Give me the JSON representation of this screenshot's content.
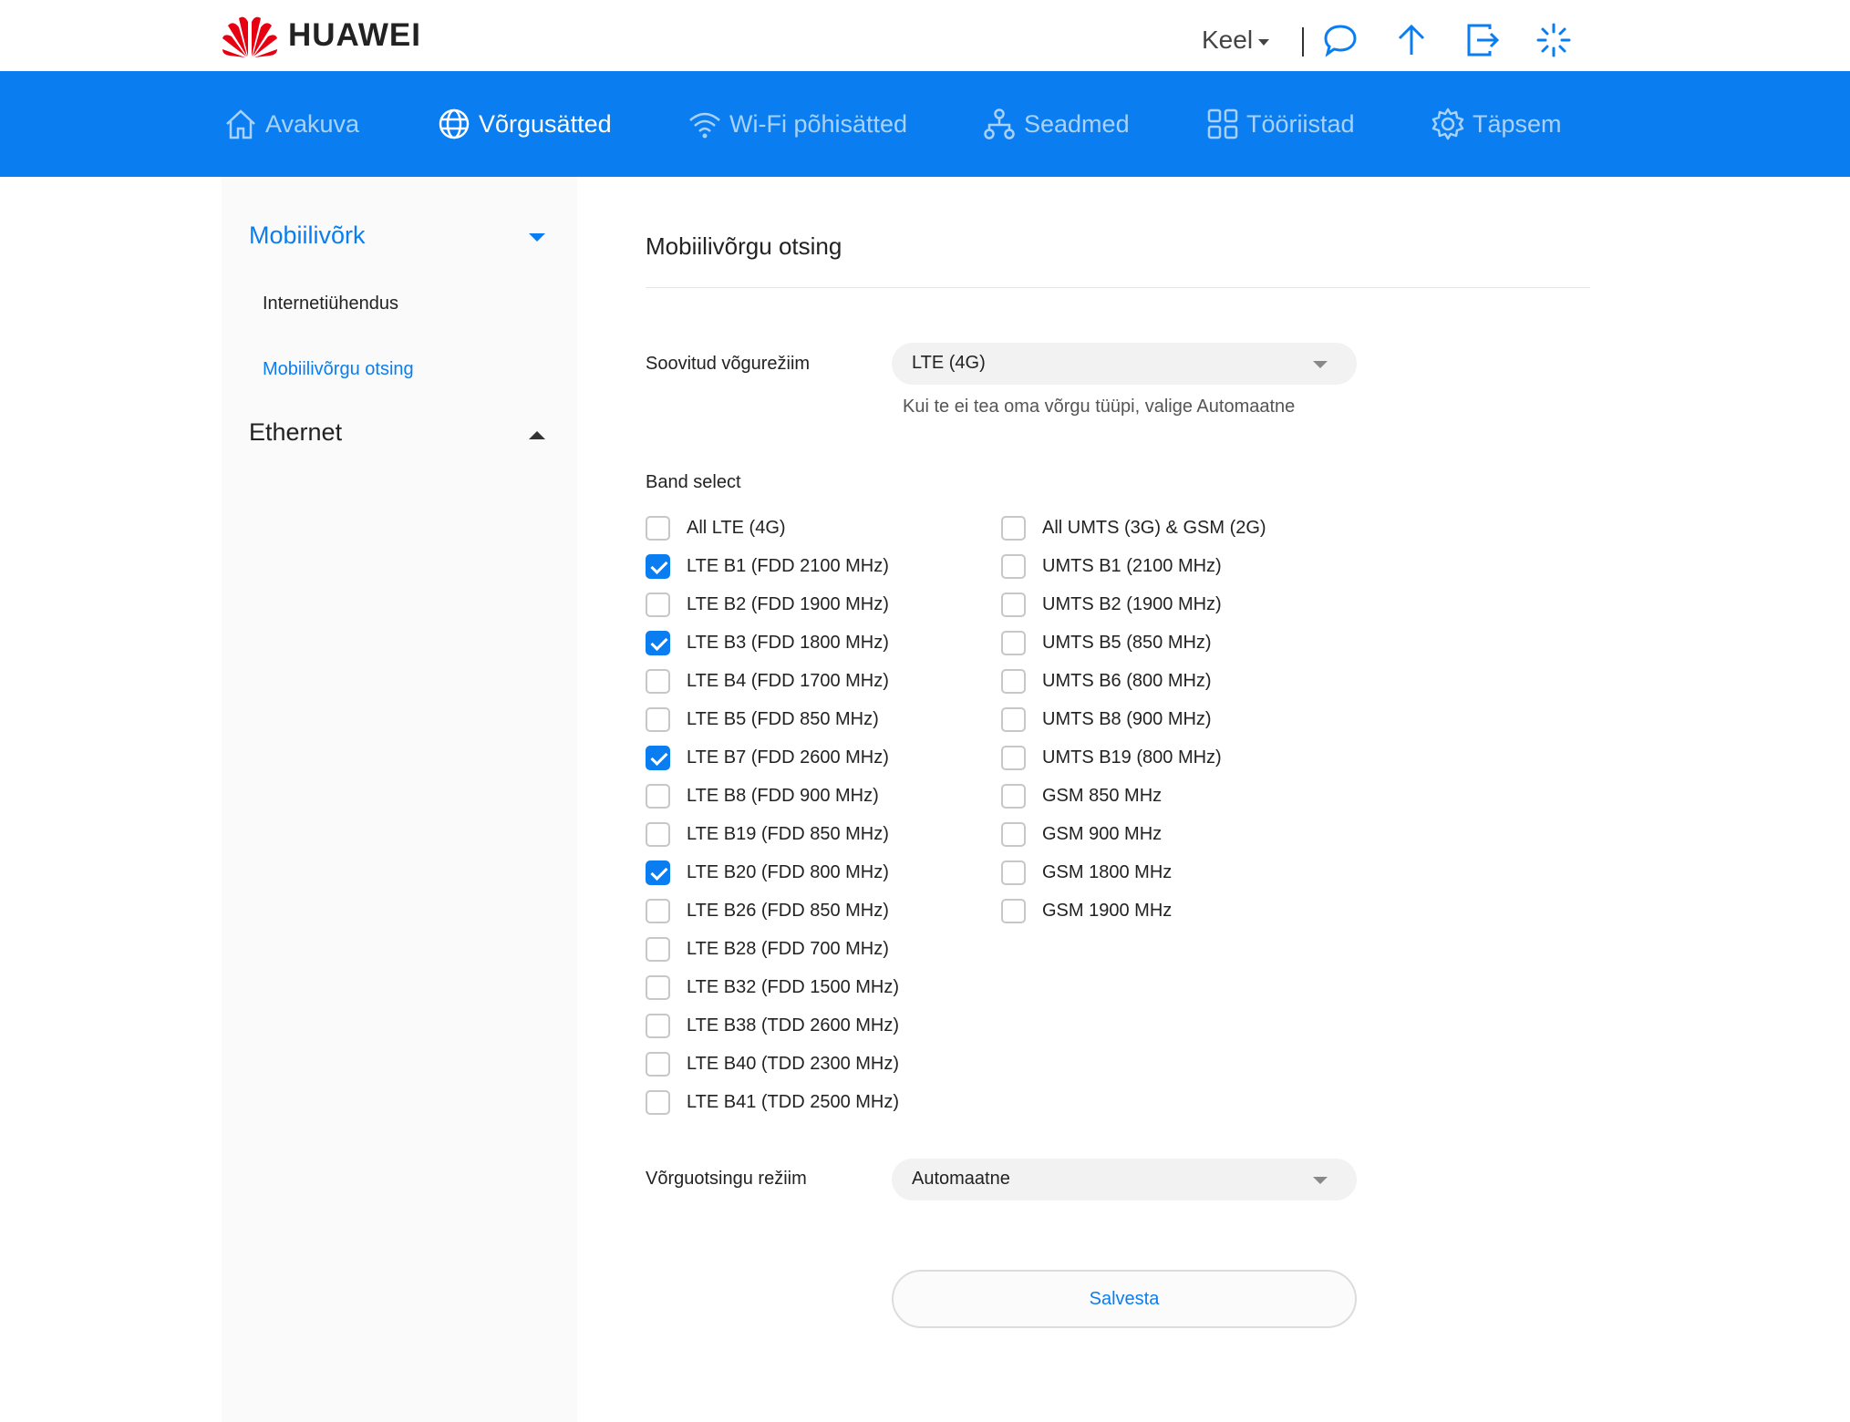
{
  "brand": {
    "name": "HUAWEI",
    "logo_color": "#e60012"
  },
  "top_actions": {
    "language_label": "Keel",
    "icons": [
      "chat-icon",
      "upload-icon",
      "logout-icon",
      "loading-icon"
    ]
  },
  "colors": {
    "accent": "#0a7ef0",
    "nav_inactive": "#a9d2fb"
  },
  "nav": {
    "items": [
      {
        "label": "Avakuva",
        "icon": "home-icon"
      },
      {
        "label": "Võrgusätted",
        "icon": "globe-icon",
        "active": true
      },
      {
        "label": "Wi-Fi põhisätted",
        "icon": "wifi-icon"
      },
      {
        "label": "Seadmed",
        "icon": "devices-icon"
      },
      {
        "label": "Tööriistad",
        "icon": "tools-icon"
      },
      {
        "label": "Täpsem",
        "icon": "gear-icon"
      }
    ]
  },
  "sidebar": {
    "sections": [
      {
        "label": "Mobiilivõrk",
        "expanded": true,
        "items": [
          {
            "label": "Internetiühendus"
          },
          {
            "label": "Mobiilivõrgu otsing",
            "active": true
          }
        ]
      },
      {
        "label": "Ethernet",
        "expanded": false
      }
    ]
  },
  "main": {
    "title": "Mobiilivõrgu otsing",
    "preferred_mode": {
      "label": "Soovitud võgurežiim",
      "value": "LTE (4G)",
      "hint": "Kui te ei tea oma võrgu tüüpi, valige Automaatne"
    },
    "band_select": {
      "title": "Band select",
      "left": [
        {
          "label": "All LTE (4G)",
          "checked": false
        },
        {
          "label": "LTE B1 (FDD 2100 MHz)",
          "checked": true
        },
        {
          "label": "LTE B2 (FDD 1900 MHz)",
          "checked": false
        },
        {
          "label": "LTE B3 (FDD 1800 MHz)",
          "checked": true
        },
        {
          "label": "LTE B4 (FDD 1700 MHz)",
          "checked": false
        },
        {
          "label": "LTE B5 (FDD 850 MHz)",
          "checked": false
        },
        {
          "label": "LTE B7 (FDD 2600 MHz)",
          "checked": true
        },
        {
          "label": "LTE B8 (FDD 900 MHz)",
          "checked": false
        },
        {
          "label": "LTE B19 (FDD 850 MHz)",
          "checked": false
        },
        {
          "label": "LTE B20 (FDD 800 MHz)",
          "checked": true
        },
        {
          "label": "LTE B26 (FDD 850 MHz)",
          "checked": false
        },
        {
          "label": "LTE B28 (FDD 700 MHz)",
          "checked": false
        },
        {
          "label": "LTE B32 (FDD 1500 MHz)",
          "checked": false
        },
        {
          "label": "LTE B38 (TDD 2600 MHz)",
          "checked": false
        },
        {
          "label": "LTE B40 (TDD 2300 MHz)",
          "checked": false
        },
        {
          "label": "LTE B41 (TDD 2500 MHz)",
          "checked": false
        }
      ],
      "right": [
        {
          "label": "All UMTS (3G) & GSM (2G)",
          "checked": false
        },
        {
          "label": "UMTS B1 (2100 MHz)",
          "checked": false
        },
        {
          "label": "UMTS B2 (1900 MHz)",
          "checked": false
        },
        {
          "label": "UMTS B5 (850 MHz)",
          "checked": false
        },
        {
          "label": "UMTS B6 (800 MHz)",
          "checked": false
        },
        {
          "label": "UMTS B8 (900 MHz)",
          "checked": false
        },
        {
          "label": "UMTS B19 (800 MHz)",
          "checked": false
        },
        {
          "label": "GSM 850 MHz",
          "checked": false
        },
        {
          "label": "GSM 900 MHz",
          "checked": false
        },
        {
          "label": "GSM 1800 MHz",
          "checked": false
        },
        {
          "label": "GSM 1900 MHz",
          "checked": false
        }
      ]
    },
    "search_mode": {
      "label": "Võrguotsingu režiim",
      "value": "Automaatne"
    },
    "save_label": "Salvesta"
  }
}
